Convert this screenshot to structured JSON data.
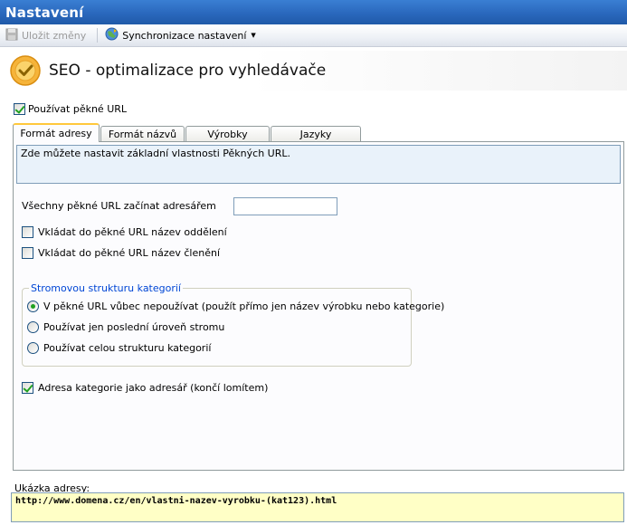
{
  "window": {
    "title": "Nastavení"
  },
  "toolbar": {
    "save_label": "Uložit změny",
    "sync_label": "Synchronizace nastavení"
  },
  "header": {
    "title": "SEO - optimalizace pro vyhledávače"
  },
  "use_pretty_urls": {
    "label": "Používat pěkné URL",
    "checked": true
  },
  "tabs": [
    {
      "label": "Formát adresy",
      "active": true
    },
    {
      "label": "Formát názvů",
      "active": false
    },
    {
      "label": "Výrobky",
      "active": false
    },
    {
      "label": "Jazyky",
      "active": false
    }
  ],
  "panel": {
    "info_text": "Zde můžete nastavit základní vlastnosti Pěkných URL.",
    "prefix_dir": {
      "label": "Všechny pěkné URL začínat adresářem",
      "value": ""
    },
    "insert_department": {
      "label": "Vkládat do pěkné URL název oddělení",
      "checked": false
    },
    "insert_division": {
      "label": "Vkládat do pěkné URL název členění",
      "checked": false
    },
    "category_tree": {
      "legend": "Stromovou strukturu kategorií",
      "options": [
        {
          "label": "V pěkné URL vůbec nepoužívat (použít přímo jen název výrobku nebo kategorie)",
          "checked": true
        },
        {
          "label": "Používat jen poslední úroveň stromu",
          "checked": false
        },
        {
          "label": "Používat celou strukturu kategorií",
          "checked": false
        }
      ]
    },
    "category_as_dir": {
      "label": "Adresa kategorie jako adresář (končí lomítem)",
      "checked": true
    }
  },
  "example": {
    "label": "Ukázka adresy:",
    "url": "http://www.domena.cz/en/vlastni-nazev-vyrobku-(kat123).html"
  },
  "colors": {
    "titlebar": "#2a68bd",
    "tab_highlight": "#ffc83c",
    "info_bg": "#e9f2fa",
    "example_bg": "#ffffc6",
    "legend_text": "#0046d5"
  }
}
